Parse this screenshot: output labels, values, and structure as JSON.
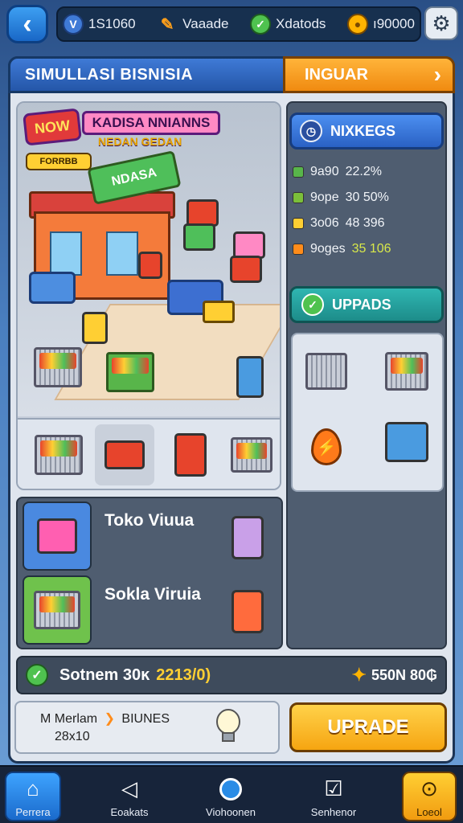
{
  "topbar": {
    "resources": [
      {
        "icon": "shield-gem-icon",
        "value": "1S1060",
        "color": "#3f7ad6"
      },
      {
        "icon": "pencil-icon",
        "value": "Vaaade",
        "color": "#ff9f1a"
      },
      {
        "icon": "check-badge-icon",
        "value": "Xdatods",
        "color": "#4fc24f"
      },
      {
        "icon": "coin-icon",
        "value": "ı90000",
        "color": "#ffb300"
      }
    ]
  },
  "header": {
    "title": "SIMULLASI BISNISIA",
    "orange_tab": "INGUAR"
  },
  "store": {
    "badge": "NOW",
    "name": "KADISA NNIANNS",
    "subname": "NEDAN GEDAN",
    "tag": "FORRBB",
    "sign": "NDASA"
  },
  "wins": {
    "title": "NIXKEGS",
    "stats": [
      {
        "label": "9a90",
        "value": "22.2%",
        "color": "#58b54a"
      },
      {
        "label": "9ope",
        "value": "30 50%",
        "color": "#7bbf3a"
      },
      {
        "label": "3o06",
        "value": "48 396",
        "color": "#ffcf33"
      },
      {
        "label": "9oges",
        "value": "35 106",
        "color": "#ff8c1a",
        "highlight": true
      }
    ]
  },
  "upgrades": {
    "title": "UPPADS"
  },
  "list": [
    {
      "label": "Toko Viuua",
      "thumb_color": "#4a89e0"
    },
    {
      "label": "Sokla Viruia",
      "thumb_color": "#6fc24c"
    }
  ],
  "status": {
    "label": "Sotnem 30ĸ",
    "number": "2213/0)",
    "right_value": "550N 80₲"
  },
  "info": {
    "line1": "M Merlam",
    "line1_b": "BIUNES",
    "line2": "28x10"
  },
  "upgrade_button": "UPRADE",
  "nav": [
    {
      "label": "Perrera",
      "icon": "home-icon"
    },
    {
      "label": "Eoakats",
      "icon": "back-triangle-icon"
    },
    {
      "label": "Viohoonen",
      "icon": "circle-icon"
    },
    {
      "label": "Senhenor",
      "icon": "checklist-icon"
    },
    {
      "label": "Loeol",
      "icon": "alert-clock-icon"
    }
  ]
}
